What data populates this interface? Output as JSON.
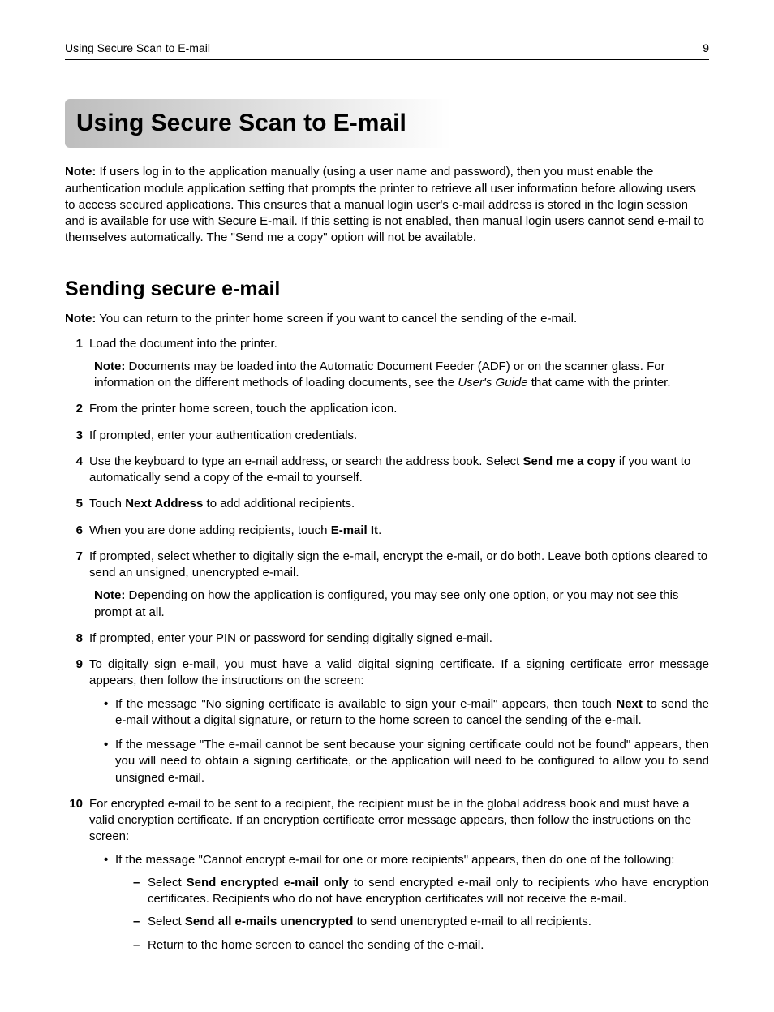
{
  "header": {
    "left": "Using Secure Scan to E-mail",
    "right": "9"
  },
  "title": "Using Secure Scan to E-mail",
  "intro": {
    "noteLabel": "Note:",
    "noteText": " If users log in to the application manually (using a user name and password), then you must enable the authentication module application setting that prompts the printer to retrieve all user information before allowing users to access secured applications. This ensures that a manual login user's e‑mail address is stored in the login session and is available for use with Secure E‑mail. If this setting is not enabled, then manual login users cannot send e‑mail to themselves automatically. The \"Send me a copy\" option will not be available."
  },
  "section": {
    "heading": "Sending secure e‑mail",
    "noteLabel": "Note:",
    "noteText": " You can return to the printer home screen if you want to cancel the sending of the e‑mail."
  },
  "steps": {
    "s1": "Load the document into the printer.",
    "s1noteLabel": "Note:",
    "s1note_a": " Documents may be loaded into the Automatic Document Feeder (ADF) or on the scanner glass. For information on the different methods of loading documents, see the ",
    "s1note_em": "User's Guide",
    "s1note_b": " that came with the printer.",
    "s2": "From the printer home screen, touch the application icon.",
    "s3": "If prompted, enter your authentication credentials.",
    "s4_a": "Use the keyboard to type an e‑mail address, or search the address book. Select ",
    "s4_b": "Send me a copy",
    "s4_c": " if you want to automatically send a copy of the e‑mail to yourself.",
    "s5_a": "Touch ",
    "s5_b": "Next Address",
    "s5_c": " to add additional recipients.",
    "s6_a": "When you are done adding recipients, touch ",
    "s6_b": "E‑mail It",
    "s6_c": ".",
    "s7": "If prompted, select whether to digitally sign the e‑mail, encrypt the e‑mail, or do both. Leave both options cleared to send an unsigned, unencrypted e‑mail.",
    "s7noteLabel": "Note:",
    "s7note": " Depending on how the application is configured, you may see only one option, or you may not see this prompt at all.",
    "s8": "If prompted, enter your PIN or password for sending digitally signed e‑mail.",
    "s9": "To digitally sign e‑mail, you must have a valid digital signing certificate. If a signing certificate error message appears, then follow the instructions on the screen:",
    "s9b1_a": "If the message \"No signing certificate is available to sign your e‑mail\" appears, then touch ",
    "s9b1_b": "Next",
    "s9b1_c": " to send the e‑mail without a digital signature, or return to the home screen to cancel the sending of the e‑mail.",
    "s9b2": "If the message \"The e‑mail cannot be sent because your signing certificate could not be found\" appears, then you will need to obtain a signing certificate, or the application will need to be configured to allow you to send unsigned e‑mail.",
    "s10": "For encrypted e‑mail to be sent to a recipient, the recipient must be in the global address book and must have a valid encryption certificate. If an encryption certificate error message appears, then follow the instructions on the screen:",
    "s10b1": "If the message \"Cannot encrypt e‑mail for one or more recipients\" appears, then do one of the following:",
    "s10d1_a": "Select ",
    "s10d1_b": "Send encrypted e‑mail only",
    "s10d1_c": " to send encrypted e‑mail only to recipients who have encryption certificates. Recipients who do not have encryption certificates will not receive the e‑mail.",
    "s10d2_a": "Select ",
    "s10d2_b": "Send all e‑mails unencrypted",
    "s10d2_c": " to send unencrypted e‑mail to all recipients.",
    "s10d3": "Return to the home screen to cancel the sending of the e‑mail."
  }
}
